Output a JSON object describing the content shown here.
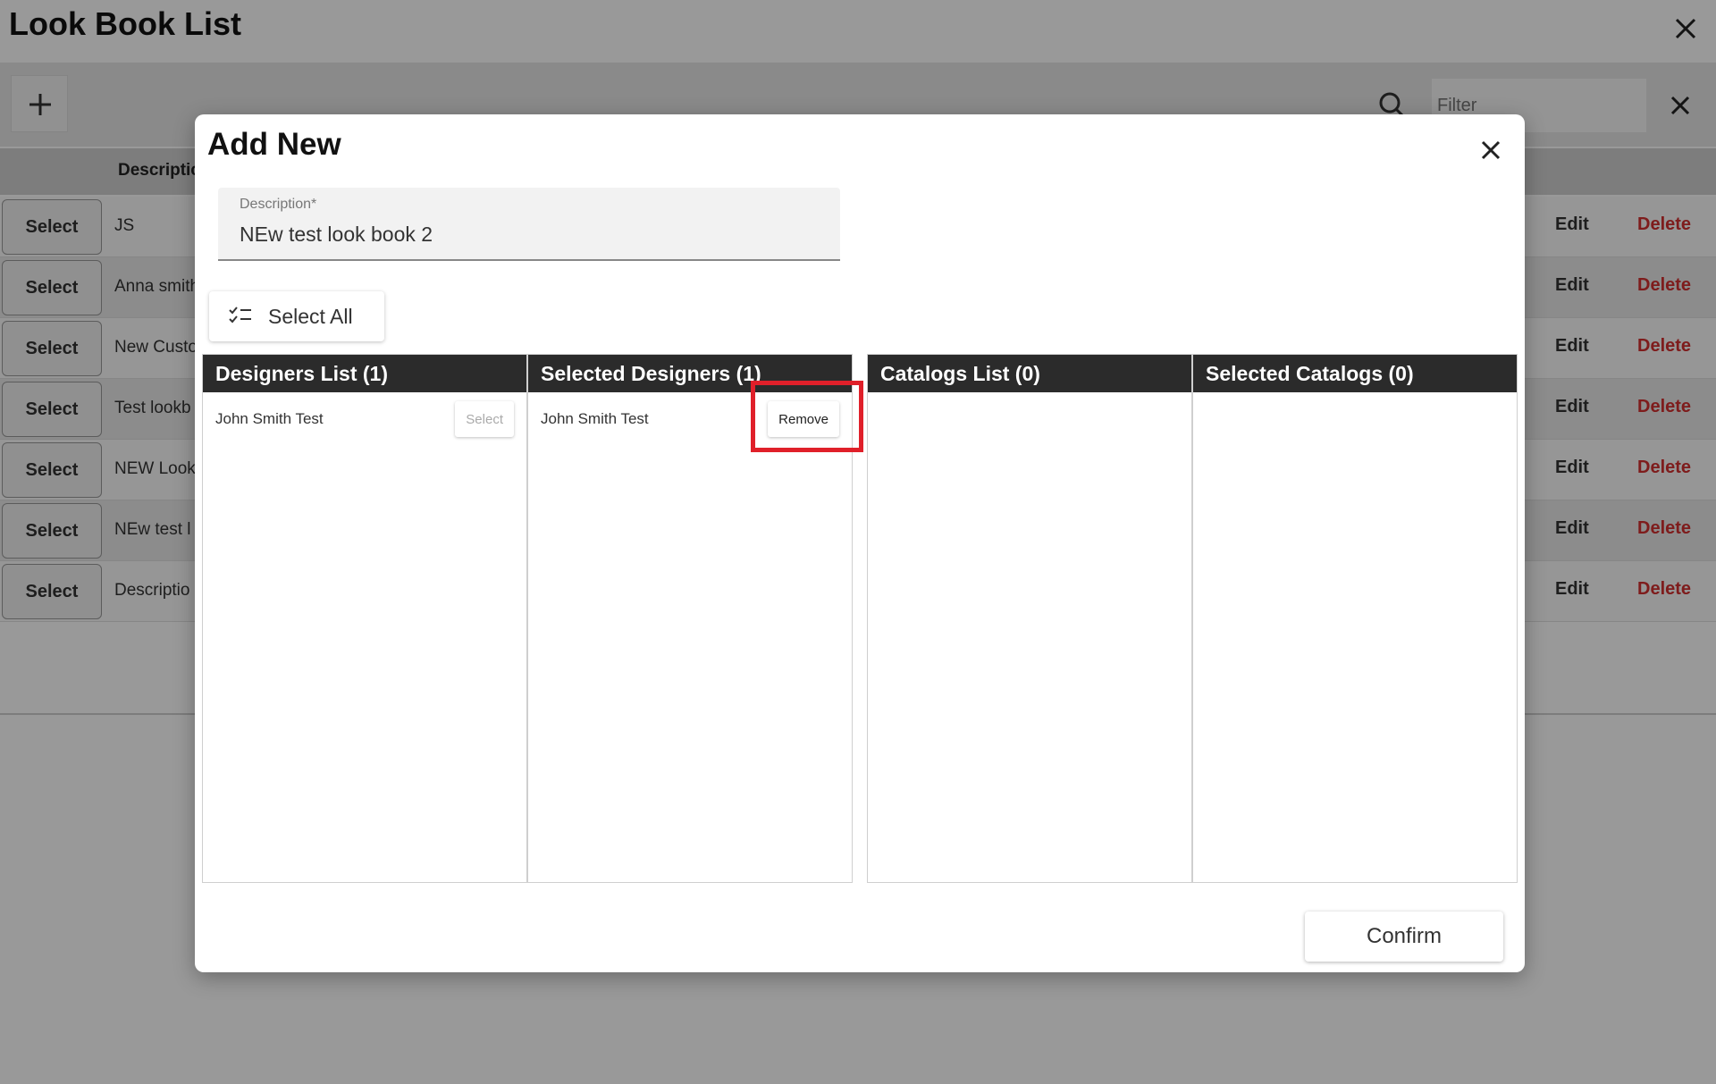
{
  "page": {
    "title": "Look Book List",
    "filter_placeholder": "Filter",
    "column_description": "Descriptic",
    "rows": [
      {
        "select_label": "Select",
        "description": "JS",
        "edit_label": "Edit",
        "delete_label": "Delete"
      },
      {
        "select_label": "Select",
        "description": "Anna smith",
        "edit_label": "Edit",
        "delete_label": "Delete"
      },
      {
        "select_label": "Select",
        "description": "New Custo",
        "edit_label": "Edit",
        "delete_label": "Delete"
      },
      {
        "select_label": "Select",
        "description": "Test lookb",
        "edit_label": "Edit",
        "delete_label": "Delete"
      },
      {
        "select_label": "Select",
        "description": "NEW Look",
        "edit_label": "Edit",
        "delete_label": "Delete"
      },
      {
        "select_label": "Select",
        "description": "NEw test l",
        "edit_label": "Edit",
        "delete_label": "Delete"
      },
      {
        "select_label": "Select",
        "description": "Descriptio",
        "edit_label": "Edit",
        "delete_label": "Delete"
      }
    ]
  },
  "modal": {
    "title": "Add New",
    "description_label": "Description*",
    "description_value": "NEw test look book 2",
    "select_all_label": "Select All",
    "panels": [
      {
        "title": "Designers List (1)",
        "items": [
          {
            "label": "John Smith Test",
            "button": "Select"
          }
        ]
      },
      {
        "title": "Selected Designers (1)",
        "items": [
          {
            "label": "John Smith Test",
            "button": "Remove"
          }
        ]
      },
      {
        "title": "Catalogs List (0)",
        "items": []
      },
      {
        "title": "Selected Catalogs (0)",
        "items": []
      }
    ],
    "confirm_label": "Confirm"
  },
  "colors": {
    "panel_header": "#2b2b2b",
    "delete_text": "#d32f2f",
    "highlight_box": "#e0202a"
  }
}
